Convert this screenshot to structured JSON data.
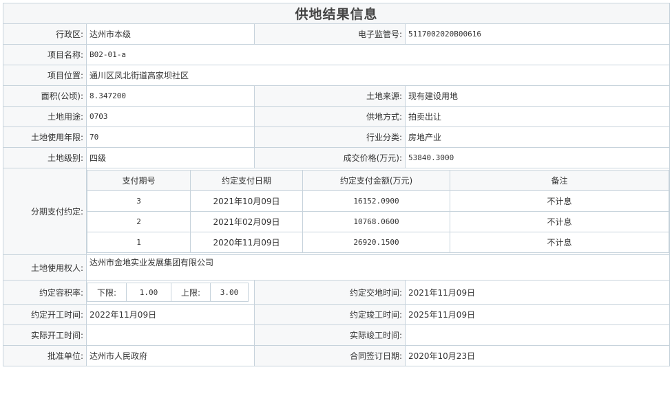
{
  "title": "供地结果信息",
  "fields": {
    "district_label": "行政区:",
    "district_value": "达州市本级",
    "supervision_no_label": "电子监管号:",
    "supervision_no_value": "5117002020B00616",
    "project_name_label": "项目名称:",
    "project_name_value": "B02-01-a",
    "project_location_label": "项目位置:",
    "project_location_value": "通川区凤北街道高家坝社区",
    "area_label": "面积(公顷):",
    "area_value": "8.347200",
    "land_source_label": "土地来源:",
    "land_source_value": "现有建设用地",
    "land_use_label": "土地用途:",
    "land_use_value": "0703",
    "supply_method_label": "供地方式:",
    "supply_method_value": "拍卖出让",
    "use_years_label": "土地使用年限:",
    "use_years_value": "70",
    "industry_label": "行业分类:",
    "industry_value": "房地产业",
    "land_grade_label": "土地级别:",
    "land_grade_value": "四级",
    "deal_price_label": "成交价格(万元):",
    "deal_price_value": "53840.3000",
    "installment_label": "分期支付约定:",
    "land_user_label": "土地使用权人:",
    "land_user_value": "达州市金地实业发展集团有限公司",
    "far_label": "约定容积率:",
    "far_lower_label": "下限:",
    "far_lower_value": "1.00",
    "far_upper_label": "上限:",
    "far_upper_value": "3.00",
    "handover_label": "约定交地时间:",
    "handover_value": "2021年11月09日",
    "start_label": "约定开工时间:",
    "start_value": "2022年11月09日",
    "complete_label": "约定竣工时间:",
    "complete_value": "2025年11月09日",
    "actual_start_label": "实际开工时间:",
    "actual_start_value": "",
    "actual_complete_label": "实际竣工时间:",
    "actual_complete_value": "",
    "approver_label": "批准单位:",
    "approver_value": "达州市人民政府",
    "contract_date_label": "合同签订日期:",
    "contract_date_value": "2020年10月23日"
  },
  "installments": {
    "headers": [
      "支付期号",
      "约定支付日期",
      "约定支付金额(万元)",
      "备注"
    ],
    "rows": [
      {
        "period": "3",
        "date": "2021年10月09日",
        "amount": "16152.0900",
        "note": "不计息"
      },
      {
        "period": "2",
        "date": "2021年02月09日",
        "amount": "10768.0600",
        "note": "不计息"
      },
      {
        "period": "1",
        "date": "2020年11月09日",
        "amount": "26920.1500",
        "note": "不计息"
      }
    ]
  }
}
